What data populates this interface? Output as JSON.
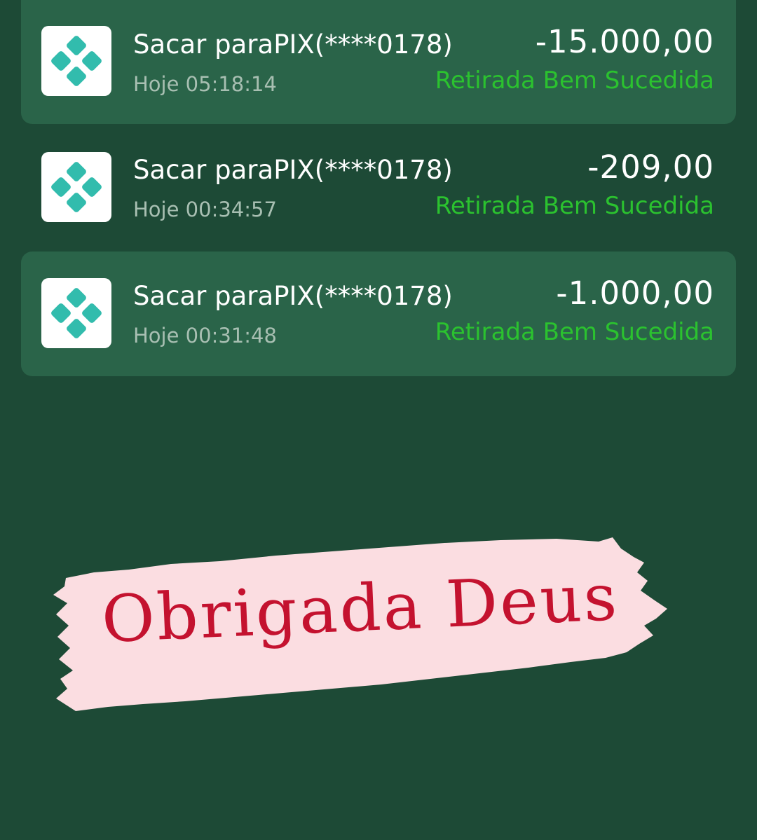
{
  "header": {
    "username_fragment": ""
  },
  "transactions": [
    {
      "icon": "pix-icon",
      "title": "Sacar paraPIX(****0178)",
      "time": "Hoje 05:18:14",
      "amount": "-15.000,00",
      "status": "Retirada Bem Sucedida"
    },
    {
      "icon": "pix-icon",
      "title": "Sacar paraPIX(****0178)",
      "time": "Hoje 00:34:57",
      "amount": "-209,00",
      "status": "Retirada Bem Sucedida"
    },
    {
      "icon": "pix-icon",
      "title": "Sacar paraPIX(****0178)",
      "time": "Hoje 00:31:48",
      "amount": "-1.000,00",
      "status": "Retirada Bem Sucedida"
    }
  ],
  "sticker": {
    "text": "Obrigada Deus",
    "text_color": "#c4122f",
    "background_color": "#fbdde1"
  },
  "colors": {
    "background": "#1d4a36",
    "card": "#2a6449",
    "status_green": "#2bc22f",
    "pix_teal": "#32bcad"
  }
}
